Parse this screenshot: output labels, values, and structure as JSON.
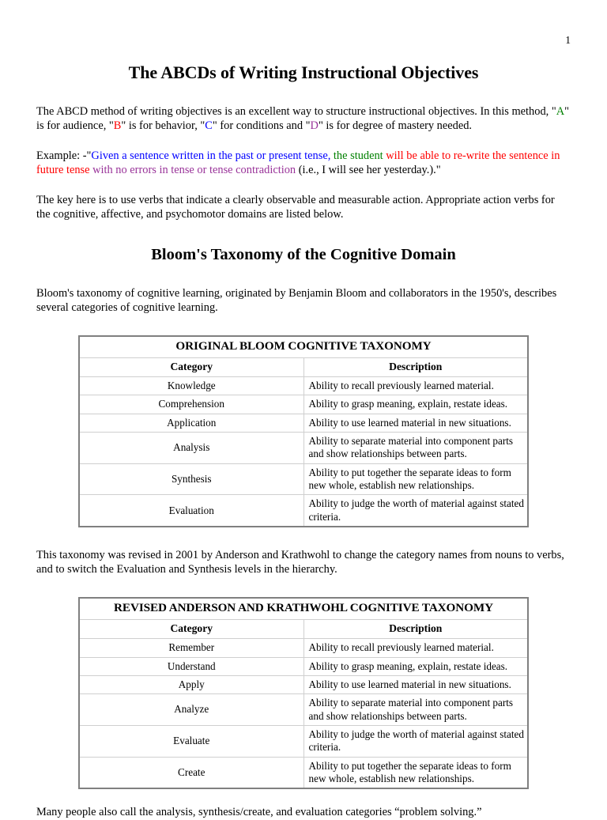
{
  "page": {
    "number": "1"
  },
  "doc": {
    "title": "The ABCDs of Writing Instructional Objectives",
    "intro": {
      "part1": "The ABCD method of writing objectives is an excellent way to structure instructional objectives. In this method, \"",
      "a": "A",
      "part2": "\" is for audience, \"",
      "b": "B",
      "part3": "\" is for behavior, \"",
      "c": "C",
      "part4": "\" for conditions and \"",
      "d": "D",
      "part5": "\" is for degree of mastery needed."
    },
    "example": {
      "label": "Example: -\"",
      "condition": "Given a sentence written in the past or present tense,",
      "audience": " the student",
      "behavior": " will be able to re-write the sentence in future tense",
      "degree": " with no errors in tense or tense contradiction",
      "tail": " (i.e., I will see her yesterday.).\""
    },
    "key_note": "The key here is to use verbs that indicate a clearly observable and measurable action. Appropriate action verbs for the cognitive, affective, and psychomotor domains are listed below.",
    "section2_title": "Bloom's Taxonomy of the Cognitive Domain",
    "bloom_intro": "Bloom's taxonomy of cognitive learning, originated by Benjamin Bloom and collaborators in the 1950's, describes several categories of cognitive learning.",
    "between_tables": "This taxonomy was revised in 2001 by Anderson and Krathwohl to change the category names from nouns to verbs, and to switch the Evaluation and Synthesis levels in the hierarchy.",
    "closing": "Many people also call the analysis, synthesis/create, and evaluation categories “problem solving.”"
  },
  "colors": {
    "audience_green": "#008000",
    "behavior_red": "#ff0000",
    "condition_blue": "#0000ff",
    "degree_purple": "#993399",
    "table_outer_border": "#808080",
    "table_inner_border": "#cfcfcf"
  },
  "table_original": {
    "title": "ORIGINAL BLOOM COGNITIVE TAXONOMY",
    "columns": [
      "Category",
      "Description"
    ],
    "rows": [
      [
        "Knowledge",
        "Ability to recall previously learned material."
      ],
      [
        "Comprehension",
        "Ability to grasp meaning, explain, restate ideas."
      ],
      [
        "Application",
        "Ability to use learned material in new situations."
      ],
      [
        "Analysis",
        "Ability to separate material into component parts and show relationships between parts."
      ],
      [
        "Synthesis",
        "Ability to put together the separate ideas to form new whole, establish new relationships."
      ],
      [
        "Evaluation",
        "Ability to judge the worth of material against stated criteria."
      ]
    ]
  },
  "table_revised": {
    "title": "REVISED ANDERSON AND KRATHWOHL COGNITIVE TAXONOMY",
    "columns": [
      "Category",
      "Description"
    ],
    "rows": [
      [
        "Remember",
        "Ability to recall previously learned material."
      ],
      [
        "Understand",
        "Ability to grasp meaning, explain, restate ideas."
      ],
      [
        "Apply",
        "Ability to use learned material in new situations."
      ],
      [
        "Analyze",
        "Ability to separate material into component parts and show relationships between parts."
      ],
      [
        "Evaluate",
        "Ability to judge the worth of material against stated criteria."
      ],
      [
        "Create",
        "Ability to put together the separate ideas to form new whole, establish new relationships."
      ]
    ]
  }
}
